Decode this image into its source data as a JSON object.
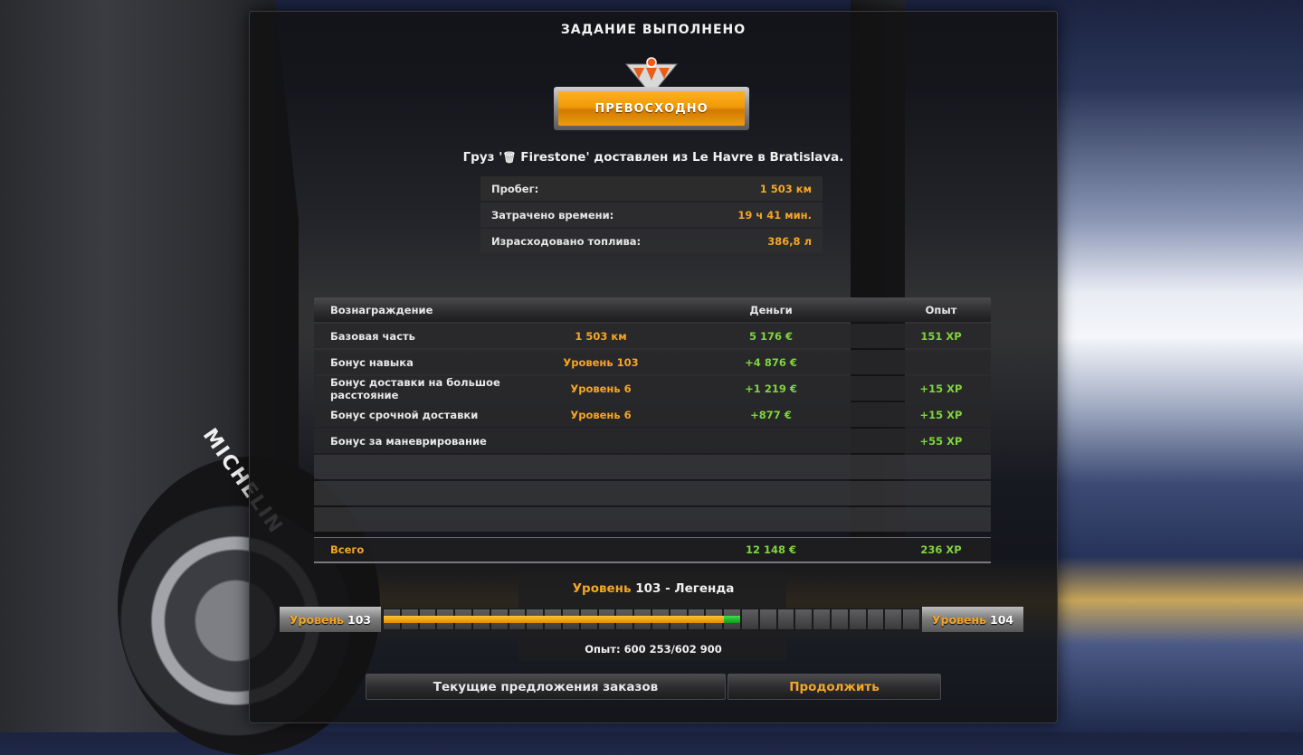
{
  "title": "ЗАДАНИЕ ВЫПОЛНЕНО",
  "rating": "ПРЕВОСХОДНО",
  "cargo": {
    "prefix": "Груз '",
    "icon": "🗑",
    "text": "Firestone' доставлен из Le Havre в Bratislava."
  },
  "stats": [
    {
      "label": "Пробег:",
      "value": "1 503 км"
    },
    {
      "label": "Затрачено времени:",
      "value": "19 ч 41 мин."
    },
    {
      "label": "Израсходовано топлива:",
      "value": "386,8 л"
    }
  ],
  "rewards": {
    "headers": {
      "reward": "Вознаграждение",
      "money": "Деньги",
      "xp": "Опыт"
    },
    "rows": [
      {
        "name": "Базовая часть",
        "detail": "1 503 км",
        "money": "5 176 €",
        "xp": "151 XP"
      },
      {
        "name": "Бонус навыка",
        "detail": "Уровень 103",
        "money": "+4 876 €",
        "xp": ""
      },
      {
        "name": "Бонус доставки на большое расстояние",
        "detail": "Уровень 6",
        "money": "+1 219 €",
        "xp": "+15 XP"
      },
      {
        "name": "Бонус срочной доставки",
        "detail": "Уровень 6",
        "money": "+877 €",
        "xp": "+15 XP"
      },
      {
        "name": "Бонус за маневрирование",
        "detail": "",
        "money": "",
        "xp": "+55 XP"
      }
    ],
    "total": {
      "label": "Всего",
      "money": "12 148 €",
      "xp": "236 XP"
    }
  },
  "level": {
    "title_word": "Уровень",
    "title_rest": "103 - Легенда",
    "current_word": "Уровень",
    "current_num": "103",
    "next_word": "Уровень",
    "next_num": "104",
    "segments_total": 30,
    "segments_filled": 19,
    "xp_text": "Опыт: 600 253/602 900"
  },
  "buttons": {
    "offers": "Текущие предложения заказов",
    "continue": "Продолжить"
  },
  "background": {
    "wheel_brand": "MICHELIN"
  },
  "colors": {
    "accent_orange": "#f5a623",
    "accent_green": "#7fd43c",
    "badge_orange": "#f19a08"
  }
}
